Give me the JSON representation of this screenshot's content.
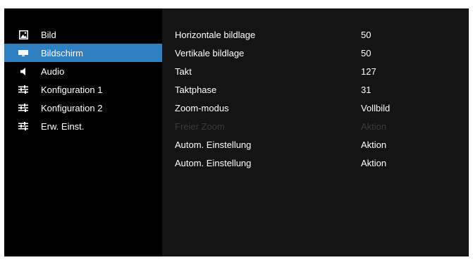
{
  "menu": {
    "items": [
      {
        "label": "Bild",
        "icon": "picture-icon"
      },
      {
        "label": "Bildschirm",
        "icon": "screen-icon"
      },
      {
        "label": "Audio",
        "icon": "speaker-icon"
      },
      {
        "label": "Konfiguration 1",
        "icon": "sliders-icon"
      },
      {
        "label": "Konfiguration 2",
        "icon": "sliders-icon"
      },
      {
        "label": "Erw. Einst.",
        "icon": "sliders-icon"
      }
    ],
    "active_index": 1
  },
  "settings": [
    {
      "name": "Horizontale bildlage",
      "value": "50"
    },
    {
      "name": "Vertikale bildlage",
      "value": "50"
    },
    {
      "name": "Takt",
      "value": "127"
    },
    {
      "name": "Taktphase",
      "value": "31"
    },
    {
      "name": "Zoom-modus",
      "value": "Vollbild"
    },
    {
      "name": "Freier Zoom",
      "value": "Aktion"
    },
    {
      "name": "Autom. Einstellung",
      "value": "Aktion"
    },
    {
      "name": "Autom. Einstellung",
      "value": "Aktion"
    }
  ],
  "colors": {
    "background": "#000000",
    "panel": "#141414",
    "highlight": "#2f7fc3",
    "text": "#ffffff",
    "disabled_text": "#3c3c3c"
  }
}
